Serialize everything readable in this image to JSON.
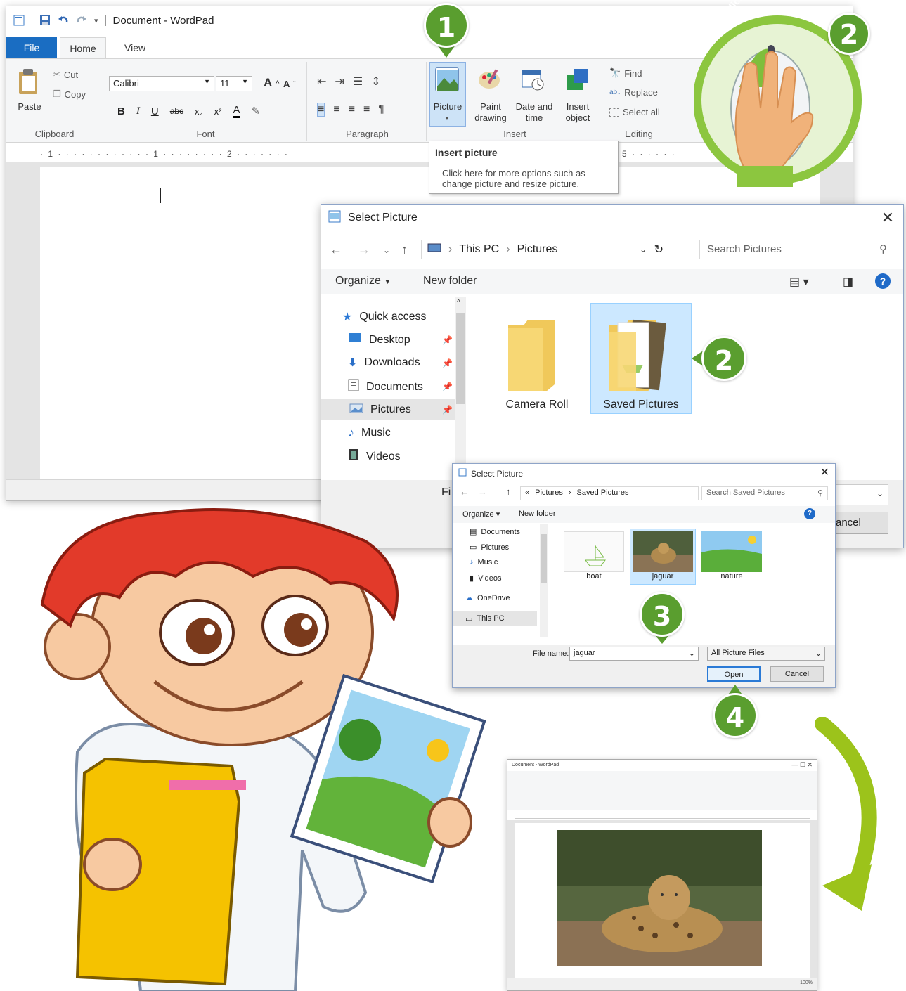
{
  "wordpad": {
    "title": "Document - WordPad",
    "tabs": {
      "file": "File",
      "home": "Home",
      "view": "View"
    },
    "clipboard": {
      "paste": "Paste",
      "cut": "Cut",
      "copy": "Copy",
      "label": "Clipboard"
    },
    "font": {
      "family": "Calibri",
      "size": "11",
      "label": "Font"
    },
    "paragraph": {
      "label": "Paragraph"
    },
    "insert": {
      "picture": "Picture",
      "paint": "Paint drawing",
      "datetime": "Date and time",
      "object": "Insert object",
      "label": "Insert"
    },
    "editing": {
      "find": "Find",
      "replace": "Replace",
      "select_all": "Select all",
      "label": "Editing"
    },
    "ruler": "· 1 · · · · · · · · · · · · 1 · · · · · · · · 2 · · · · · · ·",
    "ruler_right": "5 · · · · · ·",
    "tooltip": {
      "title": "Insert picture",
      "body": "Click here for more options such as change picture and resize picture."
    }
  },
  "dialog_large": {
    "title": "Select Picture",
    "breadcrumb": [
      "This PC",
      "Pictures"
    ],
    "search_placeholder": "Search Pictures",
    "organize": "Organize",
    "new_folder": "New folder",
    "nav": [
      "Quick access",
      "Desktop",
      "Downloads",
      "Documents",
      "Pictures",
      "Music",
      "Videos"
    ],
    "folders": [
      "Camera Roll",
      "Saved Pictures"
    ],
    "file_label_fragment": "Fi",
    "cancel_fragment": "ancel"
  },
  "dialog_small": {
    "title": "Select Picture",
    "breadcrumb": [
      "«",
      "Pictures",
      "Saved Pictures"
    ],
    "search_placeholder": "Search Saved Pictures",
    "organize": "Organize",
    "new_folder": "New folder",
    "nav": [
      "Documents",
      "Pictures",
      "Music",
      "Videos",
      "OneDrive",
      "This PC"
    ],
    "thumbnails": [
      "boat",
      "jaguar",
      "nature"
    ],
    "file_name_label": "File name:",
    "file_name_value": "jaguar",
    "file_type": "All Picture Files",
    "open": "Open",
    "cancel": "Cancel"
  },
  "badges": {
    "one": "1",
    "two": "2",
    "three": "3",
    "four": "4"
  },
  "mouse_hint": "double-click",
  "result": {
    "title": "Document - WordPad",
    "zoom": "100%"
  },
  "colors": {
    "badge_green": "#5a9e2f",
    "file_tab_blue": "#1a6dc2",
    "selection": "#cce8ff",
    "arrow": "#9cc31b"
  }
}
